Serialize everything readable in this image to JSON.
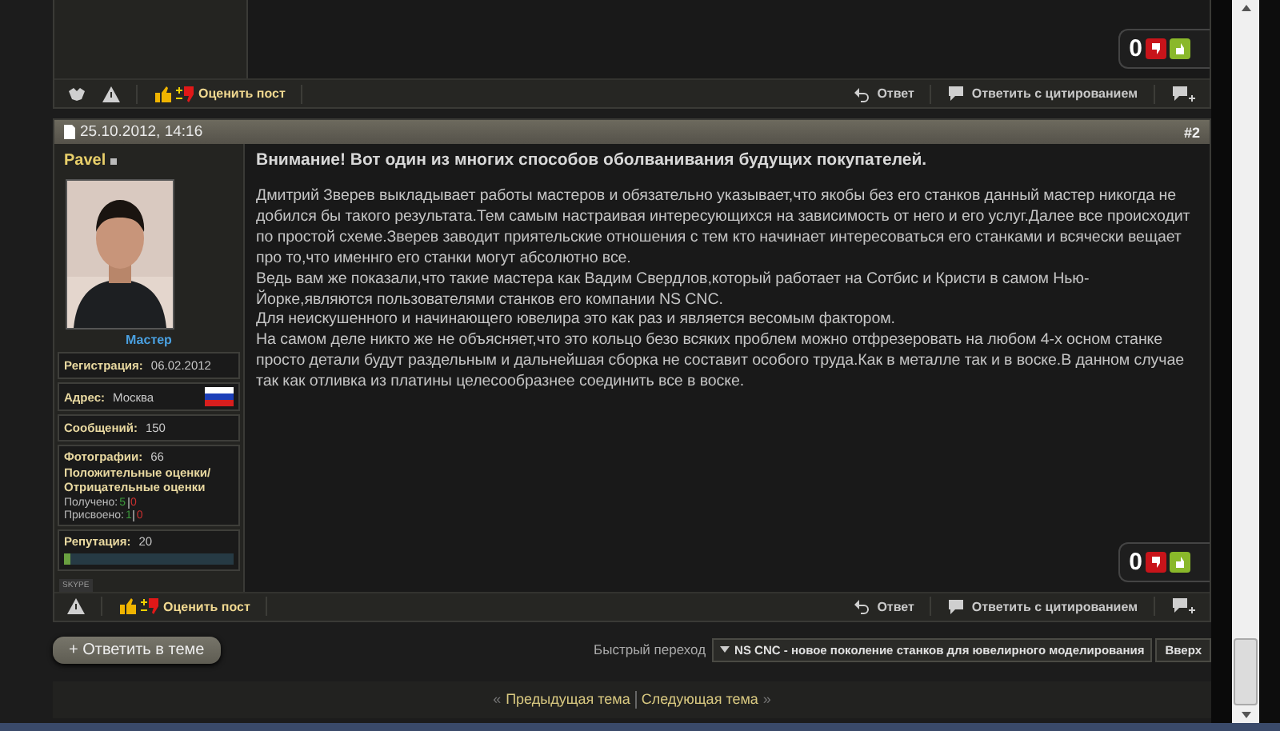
{
  "top_post": {
    "score": "0",
    "rate_label": "Оценить пост",
    "reply": "Ответ",
    "reply_quote": "Ответить с цитированием"
  },
  "post": {
    "date": "25.10.2012, 14:16",
    "number": "#2",
    "author": {
      "name": "Pavel",
      "rank": "Мастер",
      "registration": {
        "label": "Регистрация:",
        "value": "06.02.2012"
      },
      "address": {
        "label": "Адрес:",
        "value": "Москва"
      },
      "messages": {
        "label": "Сообщений:",
        "value": "150"
      },
      "photos": {
        "label": "Фотографии:",
        "value": "66"
      },
      "ratings_title": "Положительные оценки/Отрицательные оценки",
      "received": {
        "label": "Получено:",
        "positive": "5",
        "negative": "0"
      },
      "given": {
        "label": "Присвоено:",
        "positive": "1",
        "negative": "0"
      },
      "reputation": {
        "label": "Репутация:",
        "value": "20",
        "level": 0.04
      },
      "skype": "SKYPE"
    },
    "title": "Внимание! Вот один из многих способов оболванивания будущих покупателей.",
    "paragraphs": [
      "Дмитрий Зверев выкладывает работы мастеров и обязательно указывает,что якобы без его станков данный мастер никогда не добился бы такого результата.Тем самым настраивая интересующихся на зависимость от него и его услуг.Далее все происходит по простой схеме.Зверев заводит приятельские отношения с тем кто начинает интересоваться его станками и всячески вещает про то,что именнго его станки могут абсолютно все.",
      "Ведь вам же показали,что такие мастера как Вадим Свердлов,который работает на Сотбис и Кристи в самом Нью-Йорке,являются пользователями станков его компании NS CNC.",
      "Для неискушенного и начинающего ювелира это как раз и является весомым фактором.",
      "На самом деле никто же не объясняет,что это кольцо безо всяких проблем можно отфрезеровать на любом 4-х осном станке просто детали будут раздельным и дальнейшая сборка не составит особого труда.Как в металле так и в воске.В данном случае так как отливка из платины целесообразнее соединить все в воске."
    ],
    "score": "0",
    "rate_label": "Оценить пост",
    "reply": "Ответ",
    "reply_quote": "Ответить с цитированием"
  },
  "reply_thread": "+ Ответить в теме",
  "quick_jump": {
    "label": "Быстрый переход",
    "value": "NS CNC - новое поколение станков для ювелирного моделирования",
    "top": "Вверх"
  },
  "nav": {
    "prev_mark": "«",
    "prev": "Предыдущая тема",
    "next": "Следующая тема",
    "next_mark": "»"
  }
}
